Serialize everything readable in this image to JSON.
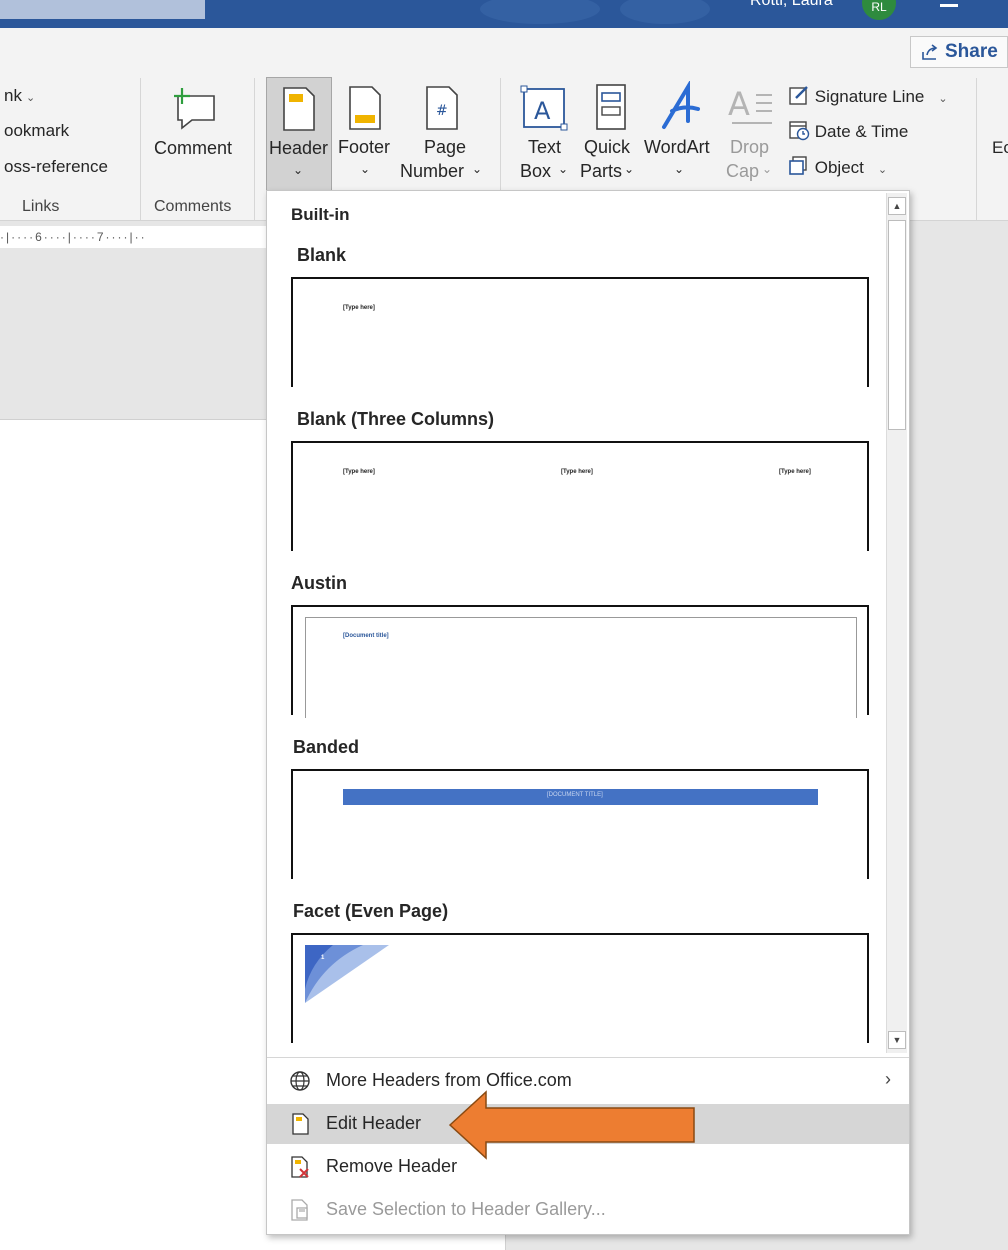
{
  "titlebar": {
    "user": "Rotti, Laura",
    "avatar_initials": "RL"
  },
  "share": {
    "label": "Share"
  },
  "ribbon": {
    "links_group": {
      "items": [
        "nk",
        "ookmark",
        "oss-reference"
      ],
      "label": "Links"
    },
    "comments_group": {
      "comment_label": "Comment",
      "label": "Comments"
    },
    "header_footer": {
      "header_label": "Header",
      "footer_label": "Footer",
      "page_label_1": "Page",
      "page_label_2": "Number"
    },
    "text_group": {
      "textbox_1": "Text",
      "textbox_2": "Box",
      "quickparts_1": "Quick",
      "quickparts_2": "Parts",
      "wordart": "WordArt",
      "dropcap_1": "Drop",
      "dropcap_2": "Cap",
      "signature": "Signature Line",
      "datetime": "Date & Time",
      "object": "Object"
    },
    "cutoff_label": "Ec"
  },
  "ruler": {
    "text": "·|····6····|····7····|··"
  },
  "gallery": {
    "category": "Built-in",
    "sections": [
      {
        "title": "Blank",
        "placeholders": [
          "[Type here]"
        ]
      },
      {
        "title": "Blank (Three Columns)",
        "placeholders": [
          "[Type here]",
          "[Type here]",
          "[Type here]"
        ]
      },
      {
        "title": "Austin",
        "placeholders": [
          "[Document title]"
        ]
      },
      {
        "title": "Banded",
        "placeholders": [
          "[DOCUMENT TITLE]"
        ]
      },
      {
        "title": "Facet (Even Page)",
        "placeholders": [
          "1"
        ]
      }
    ],
    "menu": [
      {
        "label": "More Headers from Office.com",
        "icon": "globe-icon"
      },
      {
        "label": "Edit Header",
        "icon": "page-header-icon"
      },
      {
        "label": "Remove Header",
        "icon": "remove-header-icon"
      },
      {
        "label": "Save Selection to Header Gallery...",
        "icon": "save-gallery-icon"
      }
    ]
  },
  "colors": {
    "titlebar": "#2b579a",
    "accent": "#2b579a",
    "arrow": "#ed7d31",
    "banded": "#4472c4"
  }
}
